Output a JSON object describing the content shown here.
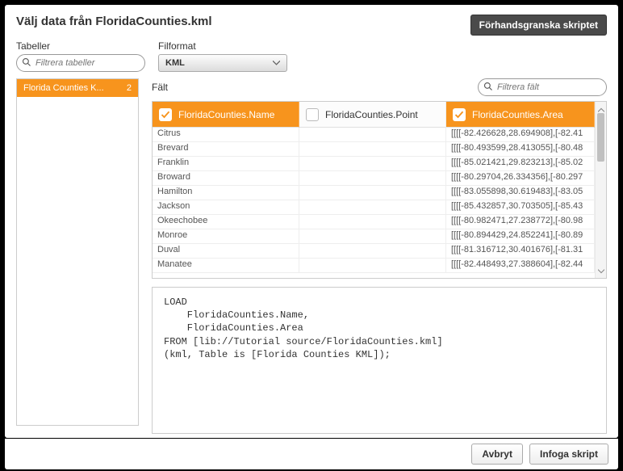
{
  "title": "Välj data från FloridaCounties.kml",
  "previewBtn": "Förhandsgranska skriptet",
  "labels": {
    "tables": "Tabeller",
    "fileformat": "Filformat",
    "fields": "Fält"
  },
  "placeholders": {
    "filterTables": "Filtrera tabeller",
    "filterFields": "Filtrera fält"
  },
  "fileFormatValue": "KML",
  "tablesList": [
    {
      "name": "Florida Counties K...",
      "count": "2"
    }
  ],
  "columns": [
    {
      "label": "FloridaCounties.Name",
      "checked": true
    },
    {
      "label": "FloridaCounties.Point",
      "checked": false
    },
    {
      "label": "FloridaCounties.Area",
      "checked": true
    }
  ],
  "rows": [
    {
      "c1": "Citrus",
      "c2": "",
      "c3": "[[[[-82.426628,28.694908],[-82.41"
    },
    {
      "c1": "Brevard",
      "c2": "",
      "c3": "[[[[-80.493599,28.413055],[-80.48"
    },
    {
      "c1": "Franklin",
      "c2": "",
      "c3": "[[[[-85.021421,29.823213],[-85.02"
    },
    {
      "c1": "Broward",
      "c2": "",
      "c3": "[[[[-80.29704,26.334356],[-80.297"
    },
    {
      "c1": "Hamilton",
      "c2": "",
      "c3": "[[[[-83.055898,30.619483],[-83.05"
    },
    {
      "c1": "Jackson",
      "c2": "",
      "c3": "[[[[-85.432857,30.703505],[-85.43"
    },
    {
      "c1": "Okeechobee",
      "c2": "",
      "c3": "[[[[-80.982471,27.238772],[-80.98"
    },
    {
      "c1": "Monroe",
      "c2": "",
      "c3": "[[[[-80.894429,24.852241],[-80.89"
    },
    {
      "c1": "Duval",
      "c2": "",
      "c3": "[[[[-81.316712,30.401676],[-81.31"
    },
    {
      "c1": "Manatee",
      "c2": "",
      "c3": "[[[[-82.448493,27.388604],[-82.44"
    }
  ],
  "script": "LOAD\n    FloridaCounties.Name,\n    FloridaCounties.Area\nFROM [lib://Tutorial source/FloridaCounties.kml]\n(kml, Table is [Florida Counties KML]);",
  "footer": {
    "cancel": "Avbryt",
    "insert": "Infoga skript"
  }
}
